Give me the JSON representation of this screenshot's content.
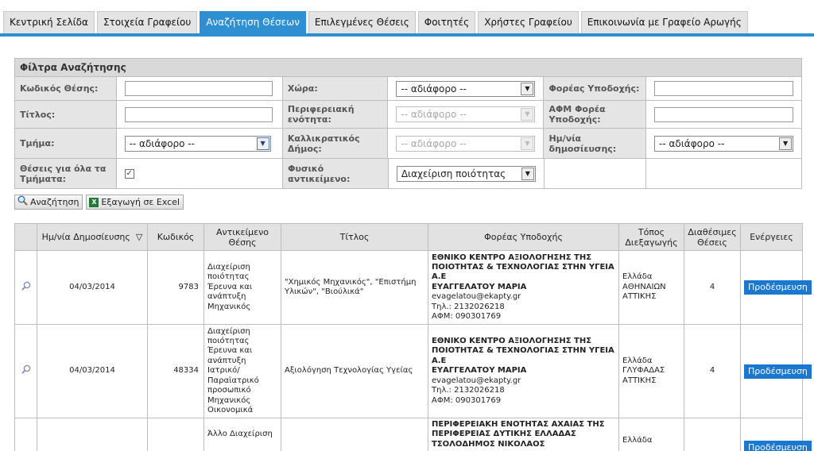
{
  "tabs": [
    {
      "label": "Κεντρική Σελίδα",
      "active": false
    },
    {
      "label": "Στοιχεία Γραφείου",
      "active": false
    },
    {
      "label": "Αναζήτηση Θέσεων",
      "active": true
    },
    {
      "label": "Επιλεγμένες Θέσεις",
      "active": false
    },
    {
      "label": "Φοιτητές",
      "active": false
    },
    {
      "label": "Χρήστες Γραφείου",
      "active": false
    },
    {
      "label": "Επικοινωνία με Γραφείο Αρωγής",
      "active": false
    }
  ],
  "filter": {
    "title": "Φίλτρα Αναζήτησης",
    "code_label": "Κωδικός Θέσης:",
    "title_label": "Τίτλος:",
    "dept_label": "Τμήμα:",
    "dept_value": "-- αδιάφορο --",
    "all_depts_label": "Θέσεις για όλα τα Τμήματα:",
    "all_depts_checked": "✓",
    "country_label": "Χώρα:",
    "country_value": "-- αδιάφορο --",
    "region_label": "Περιφερειακή ενότητα:",
    "region_value": "-- αδιάφορο --",
    "municipality_label": "Καλλικρατικός Δήμος:",
    "municipality_value": "-- αδιάφορο --",
    "subject_label": "Φυσικό αντικείμενο:",
    "subject_value": "Διαχείριση ποιότητας",
    "host_label": "Φορέας Υποδοχής:",
    "afm_label": "ΑΦΜ Φορέα Υποδοχής:",
    "date_label": "Ημ/νία δημοσίευσης:",
    "date_value": "-- αδιάφορο --"
  },
  "actions": {
    "search_label": "Αναζήτηση",
    "export_label": "Εξαγωγή σε Excel"
  },
  "table": {
    "headers": {
      "date": "Ημ/νία Δημοσίευσης",
      "sort_icon": "▽",
      "code": "Κωδικός",
      "subject": "Αντικείμενο Θέσης",
      "title": "Τίτλος",
      "host": "Φορέας Υποδοχής",
      "location": "Τόπος Διεξαγωγής",
      "seats": "Διαθέσιμες Θέσεις",
      "actions": "Ενέργειες"
    },
    "rows": [
      {
        "date": "04/03/2014",
        "code": "9783",
        "subject": "Διαχείριση ποιότητας Έρευνα και ανάπτυξη Μηχανικός",
        "title": "\"Χημικός Μηχανικός\", \"Επιστήμη Υλικών\", \"Βιούλικά\"",
        "org_name": "ΕΘΝΙΚΟ ΚΕΝΤΡΟ ΑΞΙΟΛΟΓΗΣΗΣ ΤΗΣ ΠΟΙΟΤΗΤΑΣ & ΤΕΧΝΟΛΟΓΙΑΣ ΣΤΗΝ ΥΓΕΙΑ Α.Ε",
        "contact": "ΕΥΑΓΓΕΛΑΤΟΥ ΜΑΡΙΑ",
        "email": "evagelatou@ekapty.gr",
        "phone": "Τηλ.: 2132026218",
        "afm": "ΑΦΜ: 090301769",
        "loc1": "Ελλάδα",
        "loc2": "ΑΘΗΝΑΙΩΝ",
        "loc3": "ΑΤΤΙΚΗΣ",
        "seats": "4",
        "action": "Προδέσμευση"
      },
      {
        "date": "04/03/2014",
        "code": "48334",
        "subject": "Διαχείριση ποιότητας Έρευνα και ανάπτυξη Ιατρικό/ Παραϊατρικό προσωπικό Μηχανικός Οικονομικά",
        "title": "Αξιολόγηση Τεχνολογίας Υγείας",
        "org_name": "ΕΘΝΙΚΟ ΚΕΝΤΡΟ ΑΞΙΟΛΟΓΗΣΗΣ ΤΗΣ ΠΟΙΟΤΗΤΑΣ & ΤΕΧΝΟΛΟΓΙΑΣ ΣΤΗΝ ΥΓΕΙΑ Α.Ε",
        "contact": "ΕΥΑΓΓΕΛΑΤΟΥ ΜΑΡΙΑ",
        "email": "evagelatou@ekapty.gr",
        "phone": "Τηλ.: 2132026218",
        "afm": "ΑΦΜ: 090301769",
        "loc1": "Ελλάδα",
        "loc2": "ΓΛΥΦΑΔΑΣ",
        "loc3": "ΑΤΤΙΚΗΣ",
        "seats": "4",
        "action": "Προδέσμευση"
      },
      {
        "date": "",
        "code": "",
        "subject": "Άλλο Διαχείριση",
        "title": "",
        "org_name": "ΠΕΡΙΦΕΡΕΙΑΚΗ ΕΝΟΤΗΤΑΣ ΑΧΑΙΑΣ ΤΗΣ ΠΕΡΙΦΕΡΕΙΑΣ ΔΥΤΙΚΗΣ ΕΛΛΑΔΑΣ",
        "contact": "ΤΣΟΛΟΔΗΜΟΣ ΝΙΚΟΛΑΟΣ",
        "email": "",
        "phone": "",
        "afm": "",
        "loc1": "Ελλάδα",
        "loc2": "",
        "loc3": "",
        "seats": "",
        "action": "Προδέσμευση"
      }
    ]
  }
}
